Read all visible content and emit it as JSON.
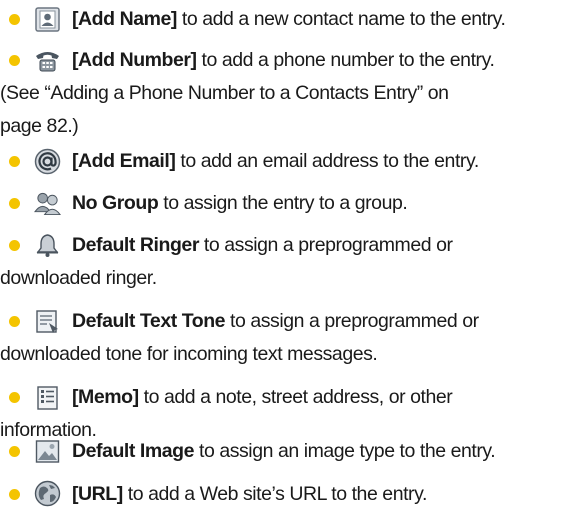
{
  "colors": {
    "bullet": "#f4c400",
    "text": "#1a1a1a"
  },
  "items": [
    {
      "icon": "add-name-icon",
      "label": "[Add Name]",
      "text": " to add a new contact name to the entry.",
      "more": []
    },
    {
      "icon": "phone-icon",
      "label": "[Add Number]",
      "text": " to add a phone number to the entry.",
      "more": [
        "(See “Adding a Phone Number to a Contacts Entry” on",
        "page 82.)"
      ]
    },
    {
      "icon": "email-at-icon",
      "label": "[Add Email]",
      "text": " to add an email address to the entry.",
      "more": []
    },
    {
      "icon": "group-icon",
      "label": "No Group",
      "text": " to assign the entry to a group.",
      "more": []
    },
    {
      "icon": "bell-icon",
      "label": "Default Ringer",
      "text": " to assign a preprogrammed or",
      "more": [
        "downloaded ringer."
      ]
    },
    {
      "icon": "message-icon",
      "label": "Default Text Tone",
      "text": " to assign a preprogrammed or",
      "more": [
        "downloaded tone for incoming text messages."
      ]
    },
    {
      "icon": "memo-icon",
      "label": "[Memo]",
      "text": " to add a note, street address, or other",
      "more": [
        "information."
      ]
    },
    {
      "icon": "picture-icon",
      "label": "Default Image",
      "text": " to assign an image type to the entry.",
      "more": []
    },
    {
      "icon": "web-icon",
      "label": "[URL]",
      "text": " to add a Web site’s URL to the entry.",
      "more": []
    }
  ]
}
